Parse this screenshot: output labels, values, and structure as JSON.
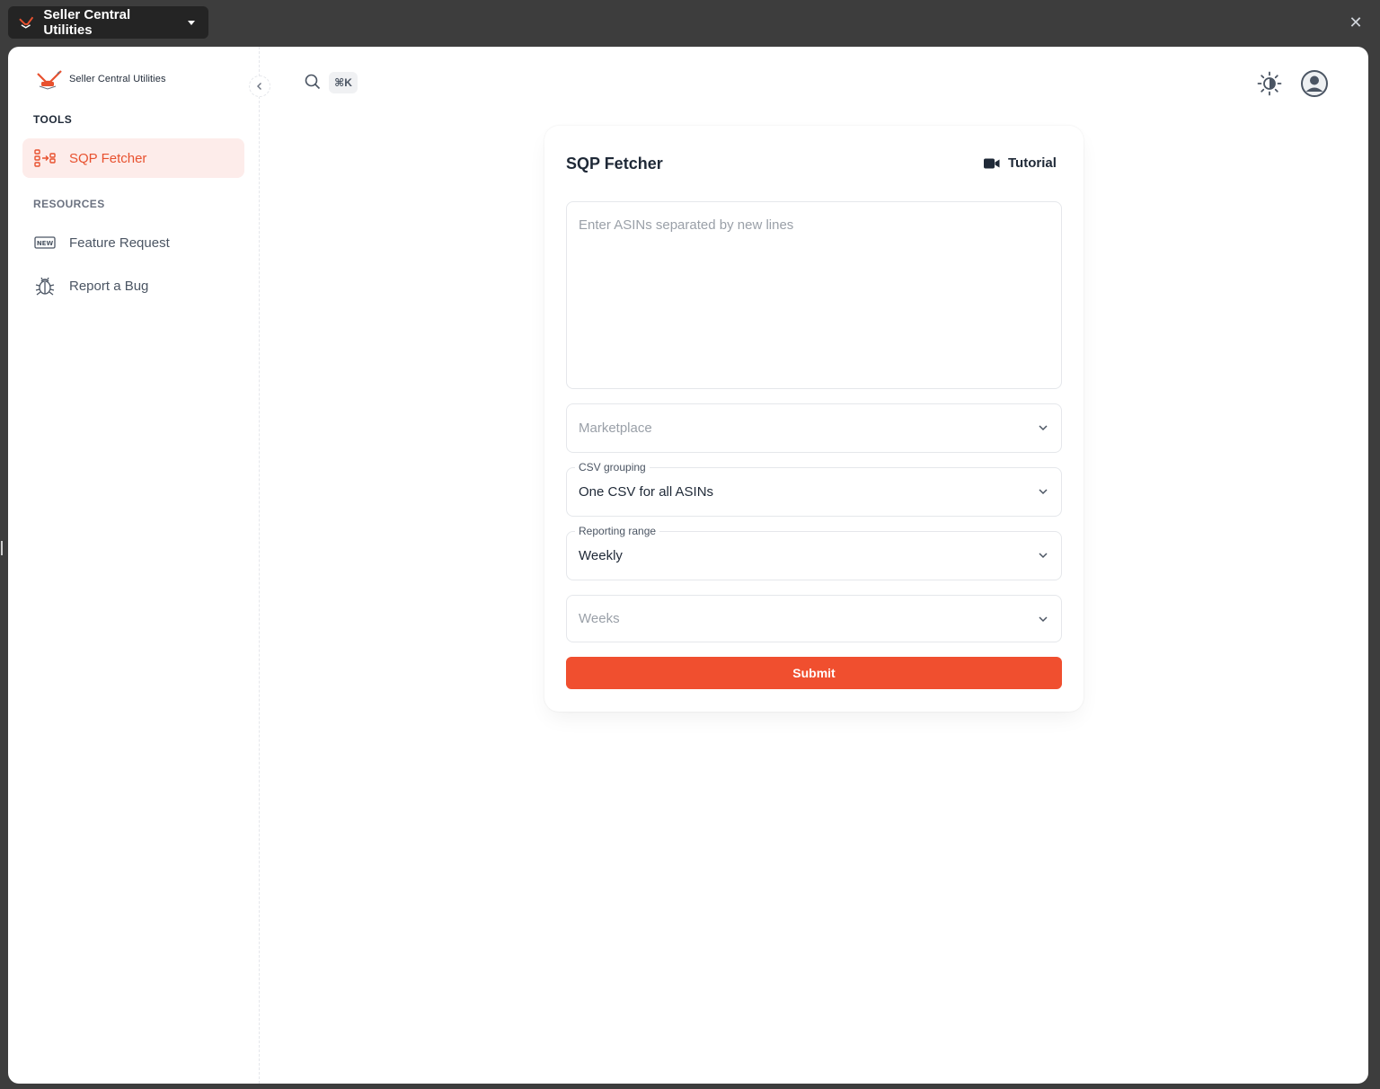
{
  "extension_bar": {
    "title": "Seller Central Utilities"
  },
  "sidebar": {
    "brand_name": "Seller Central Utilities",
    "tools_title": "TOOLS",
    "resources_title": "RESOURCES",
    "items": [
      {
        "label": "SQP Fetcher",
        "icon": "sqp-fetcher-icon",
        "active": true
      },
      {
        "label": "Feature Request",
        "icon": "new-badge-icon",
        "active": false
      },
      {
        "label": "Report a Bug",
        "icon": "bug-icon",
        "active": false
      }
    ]
  },
  "topbar": {
    "search_shortcut": "⌘K"
  },
  "form": {
    "title": "SQP Fetcher",
    "tutorial_label": "Tutorial",
    "asins_placeholder": "Enter ASINs separated by new lines",
    "marketplace_placeholder": "Marketplace",
    "csv_grouping_label": "CSV grouping",
    "csv_grouping_value": "One CSV for all ASINs",
    "reporting_range_label": "Reporting range",
    "reporting_range_value": "Weekly",
    "weeks_placeholder": "Weeks",
    "submit_label": "Submit"
  },
  "colors": {
    "accent": "#f04f2f",
    "active_bg": "#fdecea",
    "chrome_bg": "#3d3d3d"
  }
}
